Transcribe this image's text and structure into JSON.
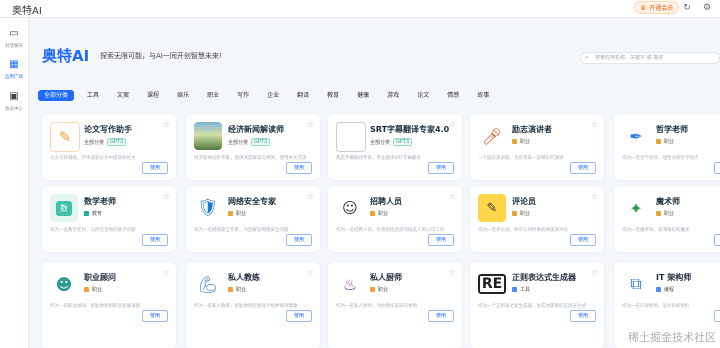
{
  "app_title": "奥特AI",
  "topbar": {
    "vip_label": "开通会员"
  },
  "sidebar": {
    "items": [
      {
        "label": "对话聊天",
        "icon": "chat-icon"
      },
      {
        "label": "应用广场",
        "icon": "grid-icon"
      },
      {
        "label": "会员中心",
        "icon": "member-icon"
      }
    ]
  },
  "hero": {
    "title": "奥特AI",
    "slogan": "探索无限可能，与AI一同开创智慧未来!"
  },
  "search": {
    "placeholder": "搜索应用名称、关键字 或 描述"
  },
  "categories": [
    "全部分类",
    "工具",
    "文案",
    "课程",
    "娱乐",
    "职业",
    "写作",
    "企业",
    "翻译",
    "教育",
    "健康",
    "游戏",
    "论文",
    "情感",
    "故事"
  ],
  "use_label": "使用",
  "cards": [
    {
      "name": "论文写作助手",
      "tag": "全部分类",
      "badge": "GPT3",
      "desc": "论文写作辅助，学术成就论文中提高你论文",
      "icon": "document-icon",
      "tag_color": "#ffffff"
    },
    {
      "name": "经济新闻解读师",
      "tag": "全部分类",
      "badge": "GPT3",
      "desc": "经济新闻分析专家，提供深度解读与预测，使用中文交流",
      "icon": "landscape-image",
      "tag_color": "#ffffff"
    },
    {
      "name": "SRT字幕翻译专家4.0",
      "tag": "全部分类",
      "badge": "GPT3",
      "desc": "我是字幕翻译专家，专业翻译SRT字幕翻译",
      "icon": "broken-image",
      "tag_color": "#ffffff"
    },
    {
      "name": "励志演讲者",
      "tag": "职业",
      "badge": "",
      "desc": "一个励志演讲家，为您带来一段精彩的演讲",
      "icon": "microphone-icon",
      "tag_color": "#f0a030"
    },
    {
      "name": "哲学老师",
      "tag": "职业",
      "badge": "",
      "desc": "作为一名哲学老师，理性分析哲学观点",
      "icon": "feather-icon",
      "tag_color": "#f0a030"
    },
    {
      "name": "数学老师",
      "tag": "教育",
      "badge": "",
      "desc": "作为一名数学老师，与你交流你的数学问题",
      "icon": "math-icon",
      "tag_color": "#2aa8a0"
    },
    {
      "name": "网络安全专家",
      "tag": "职业",
      "badge": "",
      "desc": "作为一名网络安全专家，为您解答网络安全问题",
      "icon": "shield-globe-icon",
      "tag_color": "#f0a030"
    },
    {
      "name": "招聘人员",
      "tag": "职业",
      "badge": "",
      "desc": "作为一名招聘人员，负责招揽合适的候选人到公司工作",
      "icon": "recruiter-icon",
      "tag_color": "#f0a030"
    },
    {
      "name": "评论员",
      "tag": "职业",
      "badge": "",
      "desc": "作为一名评论员，你可以对时事新闻发表评论",
      "icon": "comment-icon",
      "tag_color": "#f0a030"
    },
    {
      "name": "魔术师",
      "tag": "职业",
      "badge": "",
      "desc": "作为一名魔术师，表演精彩的魔术",
      "icon": "magic-icon",
      "tag_color": "#f0a030"
    },
    {
      "name": "职业顾问",
      "tag": "职业",
      "badge": "",
      "desc": "作为一名职业顾问，帮助你规划职业发展道路",
      "icon": "advisor-icon",
      "tag_color": "#f0a030"
    },
    {
      "name": "私人教练",
      "tag": "职业",
      "badge": "",
      "desc": "作为一名私人教练，帮助你制定健身计划并保持健康",
      "icon": "fitness-icon",
      "tag_color": "#f0a030"
    },
    {
      "name": "私人厨师",
      "tag": "职业",
      "badge": "",
      "desc": "作为一名私人厨师，为你制作美味的食物",
      "icon": "chef-icon",
      "tag_color": "#f0a030"
    },
    {
      "name": "正则表达式生成器",
      "tag": "工具",
      "badge": "",
      "desc": "作为一个正则表达式生成器，生成你需要的正则表达式",
      "icon": "regex-icon",
      "tag_color": "#4a8cf5"
    },
    {
      "name": "IT 架构师",
      "tag": "编程",
      "badge": "",
      "desc": "作为一名IT架构师，设计系统架构",
      "icon": "architecture-icon",
      "tag_color": "#4a8cf5"
    }
  ],
  "watermark": "稀土掘金技术社区"
}
